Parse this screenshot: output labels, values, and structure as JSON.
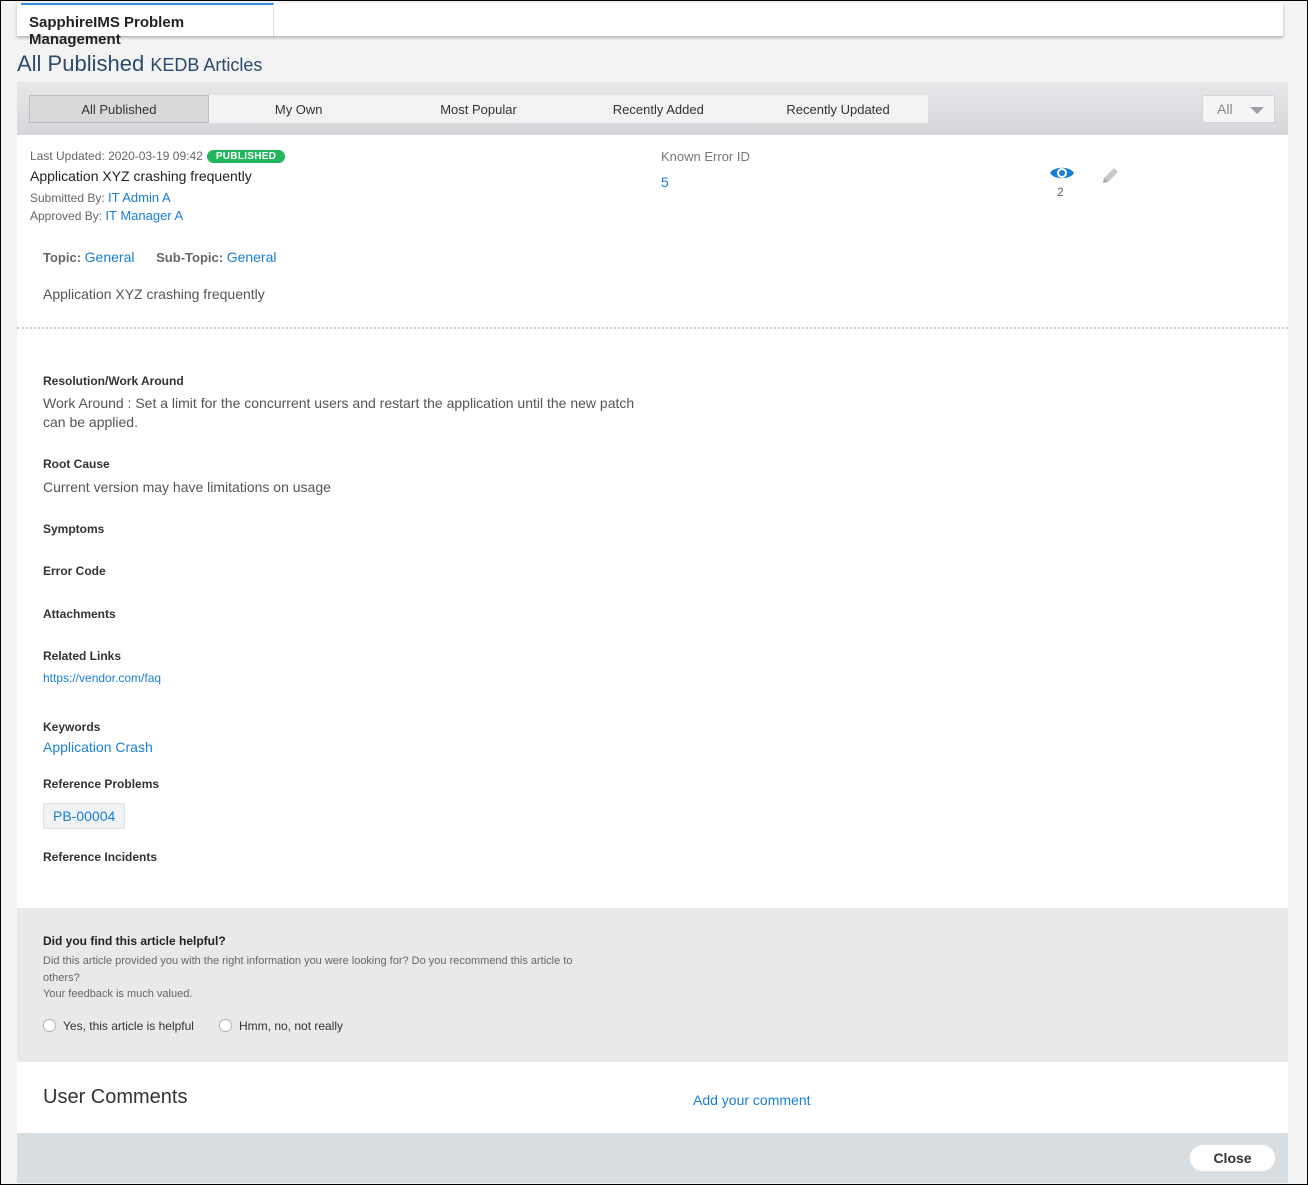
{
  "app": {
    "tab_title": "SapphireIMS Problem Management"
  },
  "page": {
    "title": "All Published",
    "subtitle": "KEDB Articles"
  },
  "filter": {
    "tabs": [
      "All Published",
      "My Own",
      "Most Popular",
      "Recently Added",
      "Recently Updated"
    ],
    "active_tab": "All Published",
    "dropdown_value": "All"
  },
  "article": {
    "last_updated_label": "Last Updated:",
    "last_updated": "2020-03-19 09:42",
    "status": "PUBLISHED",
    "title": "Application XYZ crashing frequently",
    "submitted_by_label": "Submitted By:",
    "submitted_by": "IT Admin A",
    "approved_by_label": "Approved By:",
    "approved_by": "IT Manager A",
    "known_error_label": "Known Error ID",
    "known_error_id": "5",
    "views": "2",
    "topic_label": "Topic:",
    "topic": "General",
    "subtopic_label": "Sub-Topic:",
    "subtopic": "General",
    "description": "Application XYZ crashing frequently"
  },
  "sections": {
    "resolution_label": "Resolution/Work Around",
    "resolution_line1": "Work Around : Set a limit for the concurrent users and restart the application until the new patch",
    "resolution_line2": "can be applied.",
    "root_cause_label": "Root Cause",
    "root_cause": "Current version may have limitations on usage",
    "symptoms_label": "Symptoms",
    "error_code_label": "Error Code",
    "attachments_label": "Attachments",
    "related_links_label": "Related Links",
    "related_link": "https://vendor.com/faq",
    "keywords_label": "Keywords",
    "keyword": "Application Crash",
    "ref_problems_label": "Reference Problems",
    "ref_problem": "PB-00004",
    "ref_incidents_label": "Reference Incidents"
  },
  "feedback": {
    "title": "Did you find this article helpful?",
    "text_line1": "Did this article provided you with the right information you were looking for? Do you recommend this article to",
    "text_line2": "others?",
    "text_line3": "Your feedback is much valued.",
    "option_yes": "Yes, this article is helpful",
    "option_no": "Hmm, no, not really"
  },
  "comments": {
    "title": "User Comments",
    "add_link": "Add your comment"
  },
  "footer": {
    "close_label": "Close"
  },
  "colors": {
    "accent": "#1a7fd4",
    "published_badge": "#22b75c",
    "heading": "#2c4a6e"
  },
  "icons": {
    "views": "eye-icon",
    "edit": "pencil-icon"
  }
}
